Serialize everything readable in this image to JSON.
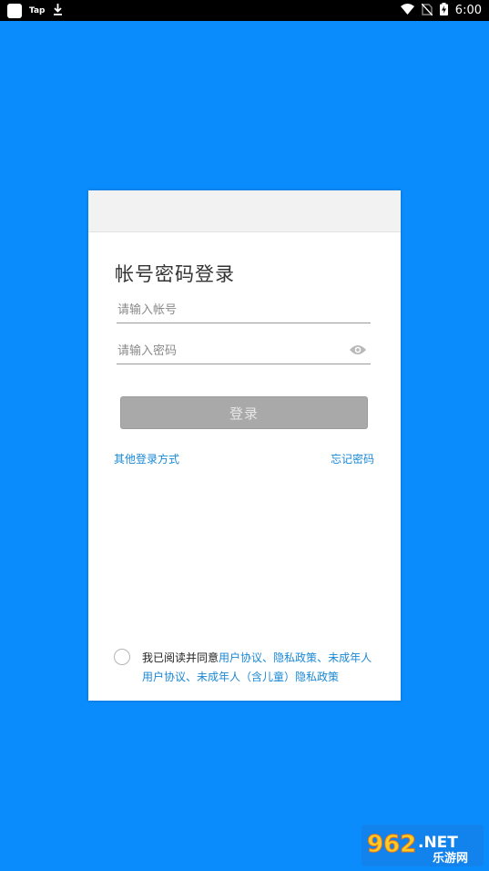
{
  "status_bar": {
    "app_label": "Tap",
    "time": "6:00"
  },
  "login": {
    "title": "帐号密码登录",
    "account_placeholder": "请输入帐号",
    "password_placeholder": "请输入密码",
    "login_button": "登录",
    "other_methods": "其他登录方式",
    "forgot_password": "忘记密码"
  },
  "agreement": {
    "prefix": "我已阅读并同意",
    "user_agreement": "用户协议",
    "sep1": "、",
    "privacy_policy": "隐私政策",
    "sep2": "、",
    "minor_user_agreement": "未成年人用户协议",
    "sep3": "、",
    "child_privacy_policy": "未成年人（含儿童）隐私政策"
  },
  "watermark": {
    "number": "962",
    "suffix": ".NET",
    "site_name": "乐游网"
  },
  "colors": {
    "background": "#0b8cfc",
    "link": "#1a88d6",
    "button_disabled": "#a9a9a9"
  }
}
